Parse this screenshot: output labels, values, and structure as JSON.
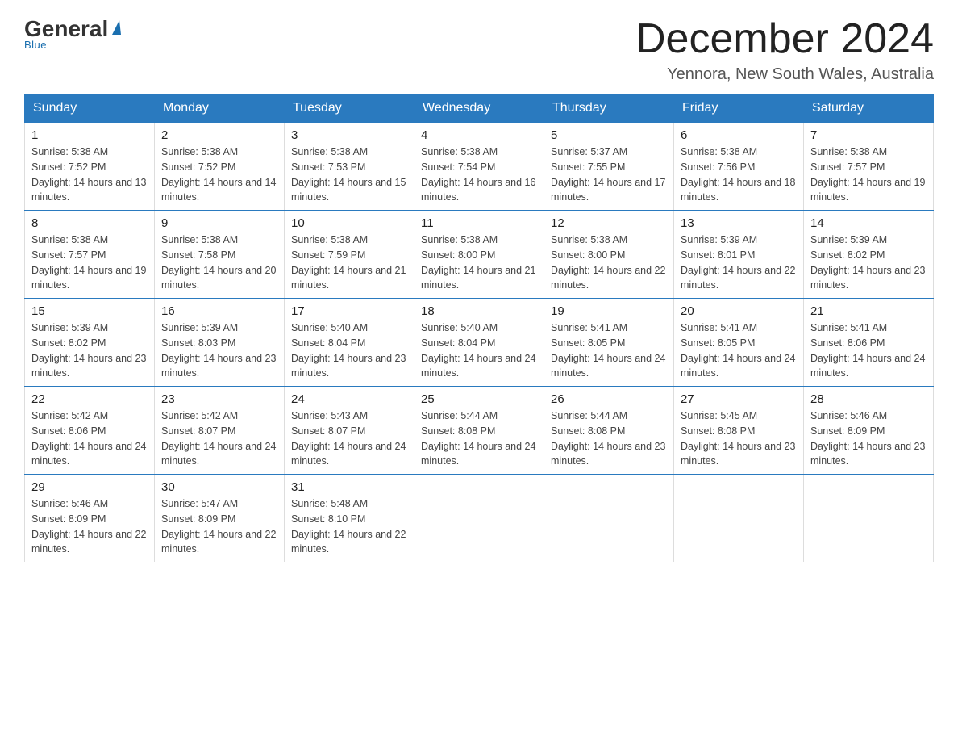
{
  "header": {
    "logo_general": "General",
    "logo_blue": "Blue",
    "month_title": "December 2024",
    "location": "Yennora, New South Wales, Australia"
  },
  "days_of_week": [
    "Sunday",
    "Monday",
    "Tuesday",
    "Wednesday",
    "Thursday",
    "Friday",
    "Saturday"
  ],
  "weeks": [
    [
      {
        "day": "1",
        "sunrise": "5:38 AM",
        "sunset": "7:52 PM",
        "daylight": "14 hours and 13 minutes."
      },
      {
        "day": "2",
        "sunrise": "5:38 AM",
        "sunset": "7:52 PM",
        "daylight": "14 hours and 14 minutes."
      },
      {
        "day": "3",
        "sunrise": "5:38 AM",
        "sunset": "7:53 PM",
        "daylight": "14 hours and 15 minutes."
      },
      {
        "day": "4",
        "sunrise": "5:38 AM",
        "sunset": "7:54 PM",
        "daylight": "14 hours and 16 minutes."
      },
      {
        "day": "5",
        "sunrise": "5:37 AM",
        "sunset": "7:55 PM",
        "daylight": "14 hours and 17 minutes."
      },
      {
        "day": "6",
        "sunrise": "5:38 AM",
        "sunset": "7:56 PM",
        "daylight": "14 hours and 18 minutes."
      },
      {
        "day": "7",
        "sunrise": "5:38 AM",
        "sunset": "7:57 PM",
        "daylight": "14 hours and 19 minutes."
      }
    ],
    [
      {
        "day": "8",
        "sunrise": "5:38 AM",
        "sunset": "7:57 PM",
        "daylight": "14 hours and 19 minutes."
      },
      {
        "day": "9",
        "sunrise": "5:38 AM",
        "sunset": "7:58 PM",
        "daylight": "14 hours and 20 minutes."
      },
      {
        "day": "10",
        "sunrise": "5:38 AM",
        "sunset": "7:59 PM",
        "daylight": "14 hours and 21 minutes."
      },
      {
        "day": "11",
        "sunrise": "5:38 AM",
        "sunset": "8:00 PM",
        "daylight": "14 hours and 21 minutes."
      },
      {
        "day": "12",
        "sunrise": "5:38 AM",
        "sunset": "8:00 PM",
        "daylight": "14 hours and 22 minutes."
      },
      {
        "day": "13",
        "sunrise": "5:39 AM",
        "sunset": "8:01 PM",
        "daylight": "14 hours and 22 minutes."
      },
      {
        "day": "14",
        "sunrise": "5:39 AM",
        "sunset": "8:02 PM",
        "daylight": "14 hours and 23 minutes."
      }
    ],
    [
      {
        "day": "15",
        "sunrise": "5:39 AM",
        "sunset": "8:02 PM",
        "daylight": "14 hours and 23 minutes."
      },
      {
        "day": "16",
        "sunrise": "5:39 AM",
        "sunset": "8:03 PM",
        "daylight": "14 hours and 23 minutes."
      },
      {
        "day": "17",
        "sunrise": "5:40 AM",
        "sunset": "8:04 PM",
        "daylight": "14 hours and 23 minutes."
      },
      {
        "day": "18",
        "sunrise": "5:40 AM",
        "sunset": "8:04 PM",
        "daylight": "14 hours and 24 minutes."
      },
      {
        "day": "19",
        "sunrise": "5:41 AM",
        "sunset": "8:05 PM",
        "daylight": "14 hours and 24 minutes."
      },
      {
        "day": "20",
        "sunrise": "5:41 AM",
        "sunset": "8:05 PM",
        "daylight": "14 hours and 24 minutes."
      },
      {
        "day": "21",
        "sunrise": "5:41 AM",
        "sunset": "8:06 PM",
        "daylight": "14 hours and 24 minutes."
      }
    ],
    [
      {
        "day": "22",
        "sunrise": "5:42 AM",
        "sunset": "8:06 PM",
        "daylight": "14 hours and 24 minutes."
      },
      {
        "day": "23",
        "sunrise": "5:42 AM",
        "sunset": "8:07 PM",
        "daylight": "14 hours and 24 minutes."
      },
      {
        "day": "24",
        "sunrise": "5:43 AM",
        "sunset": "8:07 PM",
        "daylight": "14 hours and 24 minutes."
      },
      {
        "day": "25",
        "sunrise": "5:44 AM",
        "sunset": "8:08 PM",
        "daylight": "14 hours and 24 minutes."
      },
      {
        "day": "26",
        "sunrise": "5:44 AM",
        "sunset": "8:08 PM",
        "daylight": "14 hours and 23 minutes."
      },
      {
        "day": "27",
        "sunrise": "5:45 AM",
        "sunset": "8:08 PM",
        "daylight": "14 hours and 23 minutes."
      },
      {
        "day": "28",
        "sunrise": "5:46 AM",
        "sunset": "8:09 PM",
        "daylight": "14 hours and 23 minutes."
      }
    ],
    [
      {
        "day": "29",
        "sunrise": "5:46 AM",
        "sunset": "8:09 PM",
        "daylight": "14 hours and 22 minutes."
      },
      {
        "day": "30",
        "sunrise": "5:47 AM",
        "sunset": "8:09 PM",
        "daylight": "14 hours and 22 minutes."
      },
      {
        "day": "31",
        "sunrise": "5:48 AM",
        "sunset": "8:10 PM",
        "daylight": "14 hours and 22 minutes."
      },
      null,
      null,
      null,
      null
    ]
  ]
}
